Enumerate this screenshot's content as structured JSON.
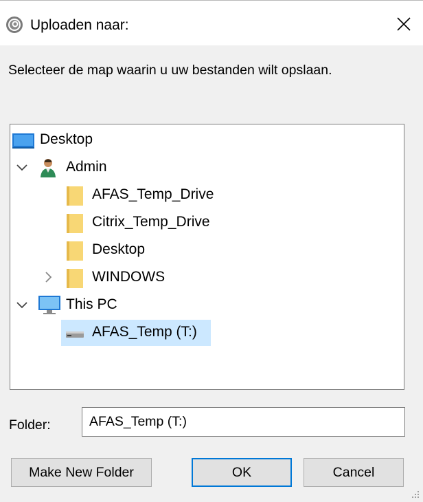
{
  "window": {
    "title": "Uploaden naar:",
    "close_glyph": "✕"
  },
  "instruction": "Selecteer de map waarin u uw bestanden wilt opslaan.",
  "tree": {
    "items": [
      {
        "label": "Desktop",
        "icon": "desktop-icon",
        "expander": "none",
        "selected": false
      },
      {
        "label": "Admin",
        "icon": "user-icon",
        "expander": "expanded",
        "selected": false
      },
      {
        "label": "AFAS_Temp_Drive",
        "icon": "folder-icon",
        "expander": "none",
        "selected": false
      },
      {
        "label": "Citrix_Temp_Drive",
        "icon": "folder-icon",
        "expander": "none",
        "selected": false
      },
      {
        "label": "Desktop",
        "icon": "folder-icon",
        "expander": "none",
        "selected": false
      },
      {
        "label": "WINDOWS",
        "icon": "folder-icon",
        "expander": "collapsed",
        "selected": false
      },
      {
        "label": "This PC",
        "icon": "computer-icon",
        "expander": "expanded",
        "selected": false
      },
      {
        "label": "AFAS_Temp (T:)",
        "icon": "drive-icon",
        "expander": "none",
        "selected": true
      }
    ]
  },
  "folder": {
    "label": "Folder:",
    "value": "AFAS_Temp (T:)"
  },
  "buttons": {
    "new_folder": "Make New Folder",
    "ok": "OK",
    "cancel": "Cancel"
  },
  "colors": {
    "selection": "#cce8ff",
    "primary_border": "#0078d7",
    "folder_yellow": "#f8d775"
  }
}
